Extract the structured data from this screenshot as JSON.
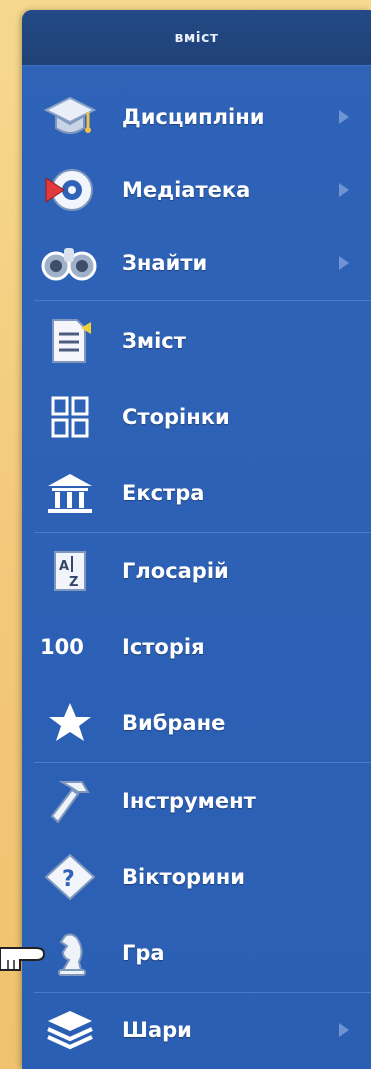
{
  "menu": {
    "title": "вміст",
    "items": [
      {
        "label": "Дисципліни",
        "icon": "graduation-cap-icon",
        "has_submenu": true
      },
      {
        "label": "Медіатека",
        "icon": "media-play-icon",
        "has_submenu": true
      },
      {
        "label": "Знайти",
        "icon": "binoculars-icon",
        "has_submenu": true
      },
      {
        "label": "Зміст",
        "icon": "document-list-icon",
        "has_submenu": false
      },
      {
        "label": "Сторінки",
        "icon": "pages-grid-icon",
        "has_submenu": false
      },
      {
        "label": "Екстра",
        "icon": "museum-building-icon",
        "has_submenu": false
      },
      {
        "label": "Глосарій",
        "icon": "glossary-az-icon",
        "has_submenu": false
      },
      {
        "label": "Історія",
        "icon": "history-counter-icon",
        "has_submenu": false
      },
      {
        "label": "Вибране",
        "icon": "star-icon",
        "has_submenu": false
      },
      {
        "label": "Інструмент",
        "icon": "hammer-icon",
        "has_submenu": false
      },
      {
        "label": "Вікторини",
        "icon": "quiz-question-icon",
        "has_submenu": false
      },
      {
        "label": "Гра",
        "icon": "chess-knight-icon",
        "has_submenu": false
      },
      {
        "label": "Шари",
        "icon": "layers-icon",
        "has_submenu": true
      }
    ],
    "history_icon_text": "100"
  },
  "colors": {
    "panel": "#2f63b8",
    "header": "#1f4176",
    "background": "#f3c879",
    "arrow": "#6f93d3"
  }
}
